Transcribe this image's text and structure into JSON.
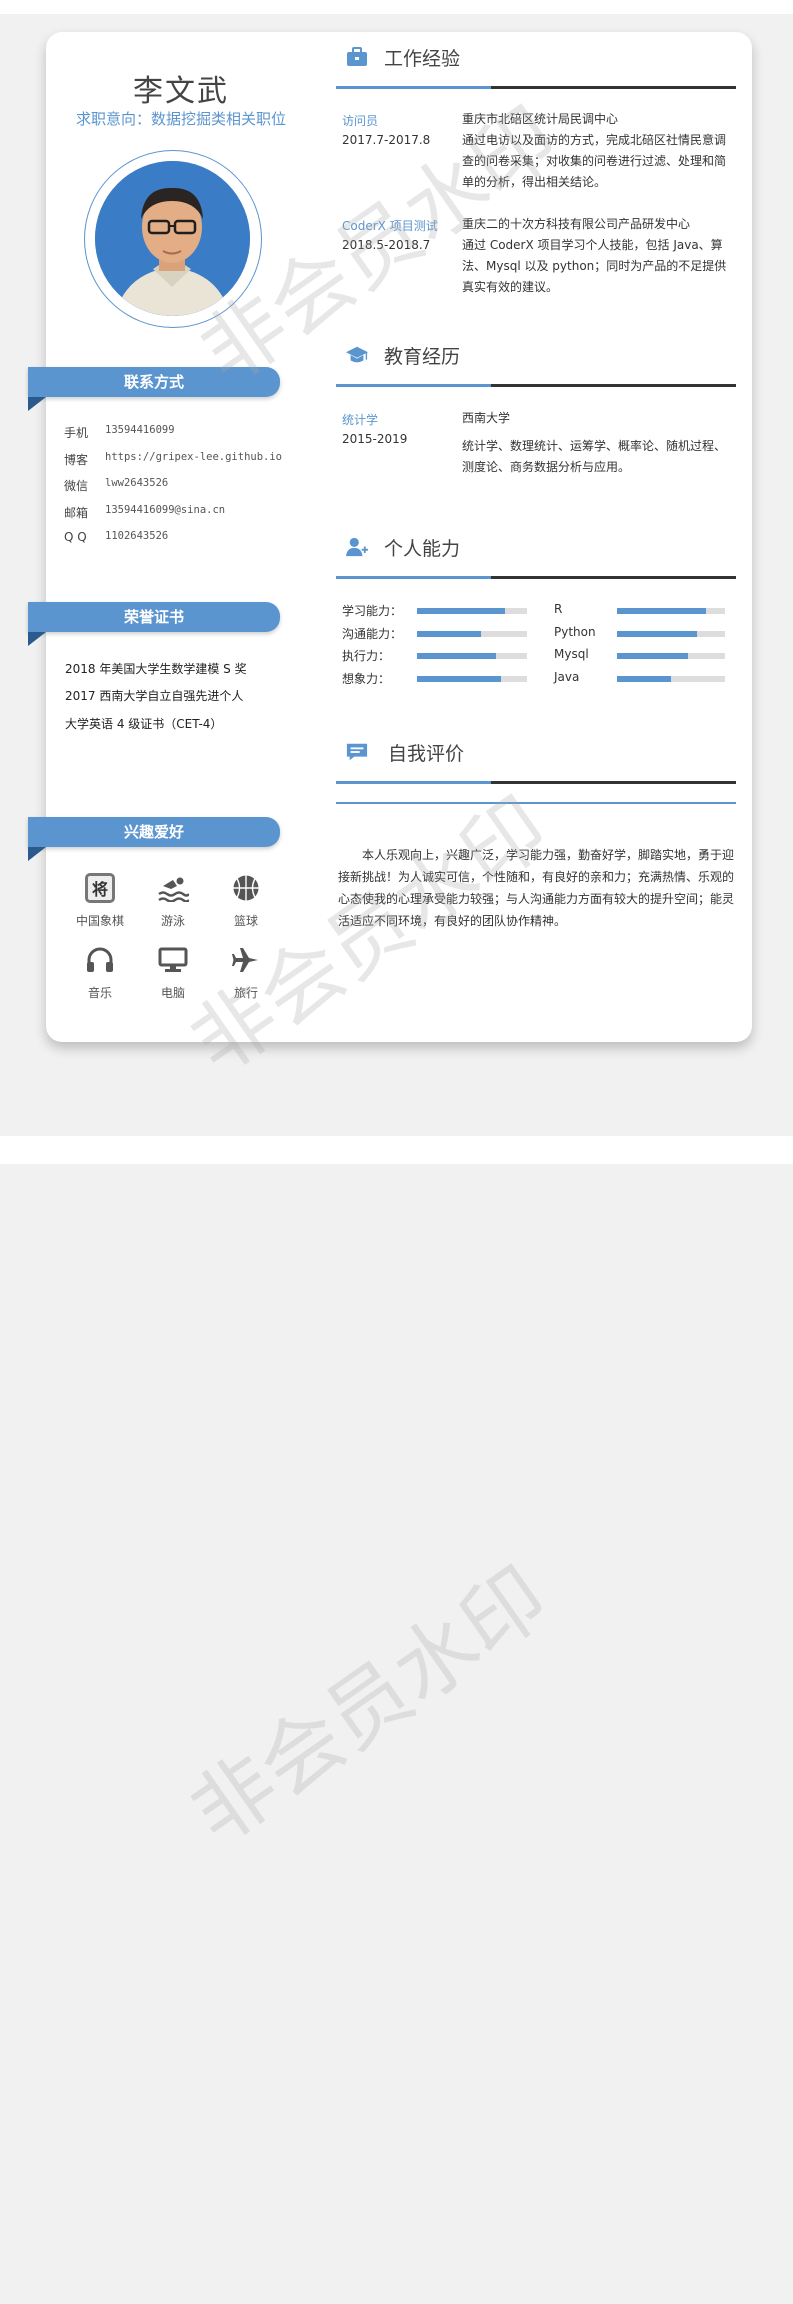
{
  "header": {
    "name": "李文武",
    "intent": "求职意向：数据挖掘类相关职位"
  },
  "contact": {
    "title": "联系方式",
    "rows": [
      {
        "label": "手机",
        "value": "13594416099"
      },
      {
        "label": "博客",
        "value": "https://gripex-lee.github.io"
      },
      {
        "label": "微信",
        "value": "lww2643526"
      },
      {
        "label": "邮箱",
        "value": "13594416099@sina.cn"
      },
      {
        "label": "Q  Q",
        "value": "1102643526"
      }
    ]
  },
  "honors": {
    "title": "荣誉证书",
    "items": [
      "2018 年美国大学生数学建模 S 奖",
      "2017 西南大学自立自强先进个人",
      "大学英语 4 级证书（CET-4）"
    ]
  },
  "hobbies": {
    "title": "兴趣爱好",
    "items": [
      {
        "label": "中国象棋",
        "icon": "chess-icon",
        "glyph": "将"
      },
      {
        "label": "游泳",
        "icon": "swimming-icon"
      },
      {
        "label": "篮球",
        "icon": "basketball-icon"
      },
      {
        "label": "音乐",
        "icon": "headphones-icon"
      },
      {
        "label": "电脑",
        "icon": "computer-icon"
      },
      {
        "label": "旅行",
        "icon": "airplane-icon"
      }
    ]
  },
  "work": {
    "title": "工作经验",
    "items": [
      {
        "role": "访问员",
        "period": "2017.7-2017.8",
        "org": "重庆市北碚区统计局民调中心",
        "desc": "通过电访以及面访的方式，完成北碚区社情民意调查的问卷采集；对收集的问卷进行过滤、处理和简单的分析，得出相关结论。"
      },
      {
        "role": "CoderX 项目测试",
        "period": "2018.5-2018.7",
        "org": "重庆二的十次方科技有限公司产品研发中心",
        "desc": "通过 CoderX 项目学习个人技能，包括 Java、算法、Mysql 以及 python；同时为产品的不足提供真实有效的建议。"
      }
    ]
  },
  "education": {
    "title": "教育经历",
    "major": "统计学",
    "period": "2015-2019",
    "school": "西南大学",
    "desc": "统计学、数理统计、运筹学、概率论、随机过程、测度论、商务数据分析与应用。"
  },
  "skills": {
    "title": "个人能力",
    "left": [
      {
        "label": "学习能力：",
        "level": 0.8
      },
      {
        "label": "沟通能力：",
        "level": 0.58
      },
      {
        "label": "执行力：",
        "level": 0.72
      },
      {
        "label": "想象力：",
        "level": 0.76
      }
    ],
    "right": [
      {
        "label": "R",
        "level": 0.82
      },
      {
        "label": "Python",
        "level": 0.74
      },
      {
        "label": "Mysql",
        "level": 0.66
      },
      {
        "label": "Java",
        "level": 0.5
      }
    ]
  },
  "self_eval": {
    "title": "自我评价",
    "text": "本人乐观向上，兴趣广泛，学习能力强，勤奋好学，脚踏实地，勇于迎接新挑战！为人诚实可信，个性随和，有良好的亲和力；充满热情、乐观的心态使我的心理承受能力较强；与人沟通能力方面有较大的提升空间；能灵活适应不同环境，有良好的团队协作精神。"
  },
  "watermark": "非会员水印",
  "colors": {
    "accent": "#5b95cf",
    "dark": "#333333",
    "page_bg": "#f1f1f1"
  }
}
